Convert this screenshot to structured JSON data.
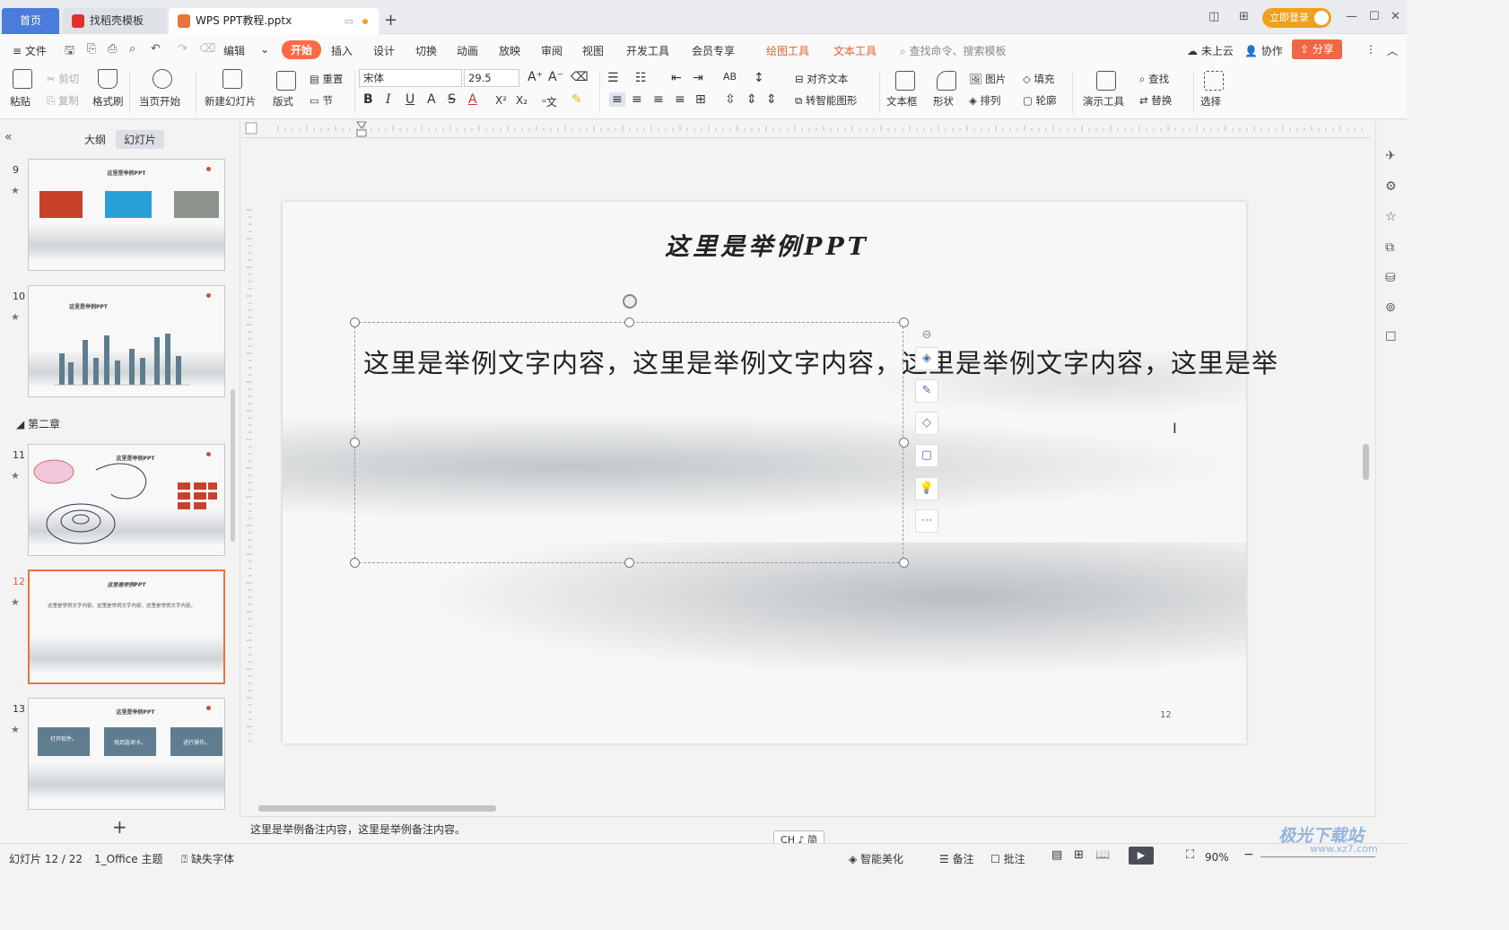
{
  "titlebar": {
    "home_tab": "首页",
    "tabs": [
      {
        "label": "找稻壳模板"
      },
      {
        "label": "WPS PPT教程.pptx"
      }
    ],
    "login_label": "立即登录"
  },
  "menubar": {
    "file_label": "文件",
    "edit_label": "编辑",
    "items": [
      "开始",
      "插入",
      "设计",
      "切换",
      "动画",
      "放映",
      "审阅",
      "视图",
      "开发工具",
      "会员专享"
    ],
    "context_tabs": [
      "绘图工具",
      "文本工具"
    ],
    "search_placeholder": "查找命令、搜索模板",
    "cloud_label": "未上云",
    "collab_label": "协作",
    "share_label": "分享"
  },
  "ribbon": {
    "paste": "粘贴",
    "cut": "剪切",
    "copy": "复制",
    "format_painter": "格式刷",
    "from_current": "当页开始",
    "new_slide": "新建幻灯片",
    "layout": "版式",
    "reset": "重置",
    "section": "节",
    "font_name": "宋体",
    "font_size": "29.5",
    "align_text": "对齐文本",
    "convert_smartart": "转智能图形",
    "text_box": "文本框",
    "shape": "形状",
    "picture": "图片",
    "fill": "填充",
    "arrange": "排列",
    "outline": "轮廓",
    "present_tools": "演示工具",
    "find": "查找",
    "replace": "替换",
    "select": "选择"
  },
  "leftpanel": {
    "tab_outline": "大纲",
    "tab_slides": "幻灯片",
    "section_name": "第二章",
    "slides": [
      {
        "num": "9",
        "title": "这里是举例PPT"
      },
      {
        "num": "10",
        "title": "这里是举例PPT"
      },
      {
        "num": "11",
        "title": "这里是举例PPT"
      },
      {
        "num": "12",
        "title": "这里是举例PPT",
        "body": "这里是举例文字内容，这里是举例文字内容，这里是举例文字内容，"
      },
      {
        "num": "13",
        "title": "这里是举例PPT",
        "boxes": [
          "打开软件。",
          "找到选项卡。",
          "进行操作。"
        ]
      }
    ]
  },
  "slide": {
    "title": "这里是举例PPT",
    "body": "这里是举例文字内容，这里是举例文字内容，这里是举例文字内容，这里是举",
    "page_number": "12"
  },
  "notes": {
    "text": "这里是举例备注内容，这里是举例备注内容。"
  },
  "ime": "CH ♪ 简",
  "statusbar": {
    "slide_count": "幻灯片 12 / 22",
    "theme": "1_Office 主题",
    "missing_font": "缺失字体",
    "smart_beautify": "智能美化",
    "notes_label": "备注",
    "comments_label": "批注",
    "zoom": "90%"
  },
  "watermark": "极光下载站",
  "watermark_sub": "www.xz7.com"
}
